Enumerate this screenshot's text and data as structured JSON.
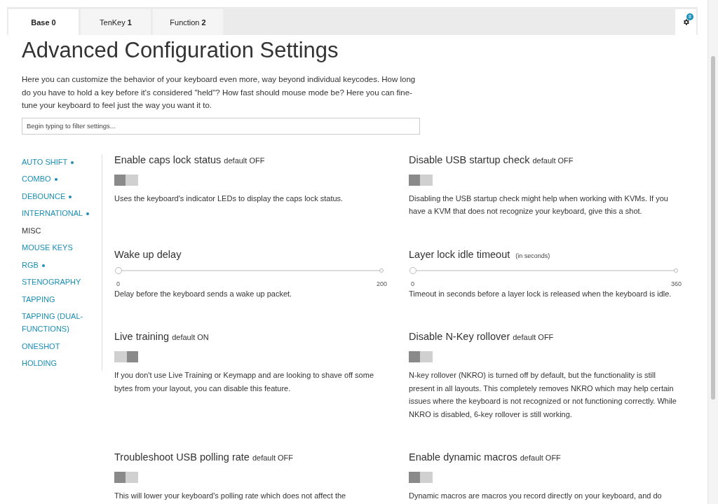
{
  "tabs": [
    {
      "label": "Base",
      "index": "0",
      "selected": true
    },
    {
      "label": "TenKey",
      "index": "1",
      "selected": false
    },
    {
      "label": "Function",
      "index": "2",
      "selected": false
    }
  ],
  "settings_button": {
    "badge": "8"
  },
  "title": "Advanced Configuration Settings",
  "intro": "Here you can customize the behavior of your keyboard even more, way beyond individual keycodes. How long do you have to hold a key before it's considered \"held\"? How fast should mouse mode be? Here you can fine-tune your keyboard to feel just the way you want it to.",
  "filter": {
    "placeholder": "Begin typing to filter settings..."
  },
  "sidebar": {
    "items": [
      {
        "label": "AUTO SHIFT",
        "modified": true,
        "selected": false
      },
      {
        "label": "COMBO",
        "modified": true,
        "selected": false
      },
      {
        "label": "DEBOUNCE",
        "modified": true,
        "selected": false
      },
      {
        "label": "INTERNATIONAL",
        "modified": true,
        "selected": false
      },
      {
        "label": "MISC",
        "modified": false,
        "selected": true
      },
      {
        "label": "MOUSE KEYS",
        "modified": false,
        "selected": false
      },
      {
        "label": "RGB",
        "modified": true,
        "selected": false
      },
      {
        "label": "STENOGRAPHY",
        "modified": false,
        "selected": false
      },
      {
        "label": "TAPPING",
        "modified": false,
        "selected": false
      },
      {
        "label": "TAPPING (DUAL-FUNCTIONS)",
        "modified": false,
        "selected": false
      },
      {
        "label": "ONESHOT",
        "modified": false,
        "selected": false
      },
      {
        "label": "HOLDING",
        "modified": false,
        "selected": false
      }
    ]
  },
  "settings": [
    {
      "kind": "toggle",
      "title": "Enable caps lock status",
      "note": "default OFF",
      "on": false,
      "description": "Uses the keyboard's indicator LEDs to display the caps lock status."
    },
    {
      "kind": "toggle",
      "title": "Disable USB startup check",
      "note": "default OFF",
      "on": false,
      "description": "Disabling the USB startup check might help when working with KVMs. If you have a KVM that does not recognize your keyboard, give this a shot."
    },
    {
      "kind": "slider",
      "title": "Wake up delay",
      "level": 0,
      "min": "0",
      "max": "200",
      "description": "Delay before the keyboard sends a wake up packet."
    },
    {
      "kind": "slider",
      "title": "Layer lock idle timeout",
      "unit": "(in seconds)",
      "level": 0,
      "min": "0",
      "max": "360",
      "description": "Timeout in seconds before a layer lock is released when the keyboard is idle."
    },
    {
      "kind": "toggle",
      "title": "Live training",
      "note": "default ON",
      "on": true,
      "description": "If you don't use Live Training or Keymapp and are looking to shave off some bytes from your layout, you can disable this feature."
    },
    {
      "kind": "toggle",
      "title": "Disable N-Key rollover",
      "note": "default OFF",
      "on": false,
      "description": "N-key rollover (NKRO) is turned off by default, but the functionality is still present in all layouts. This completely removes NKRO which may help certain issues where the keyboard is not recognized or not functioning correctly. While NKRO is disabled, 6-key rollover is still working."
    },
    {
      "kind": "toggle",
      "title": "Troubleshoot USB polling rate",
      "note": "default OFF",
      "on": false,
      "description": "This will lower your keyboard's polling rate which does not affect the"
    },
    {
      "kind": "toggle",
      "title": "Enable dynamic macros",
      "note": "default OFF",
      "on": false,
      "description": "Dynamic macros are macros you record directly on your keyboard, and do"
    }
  ]
}
